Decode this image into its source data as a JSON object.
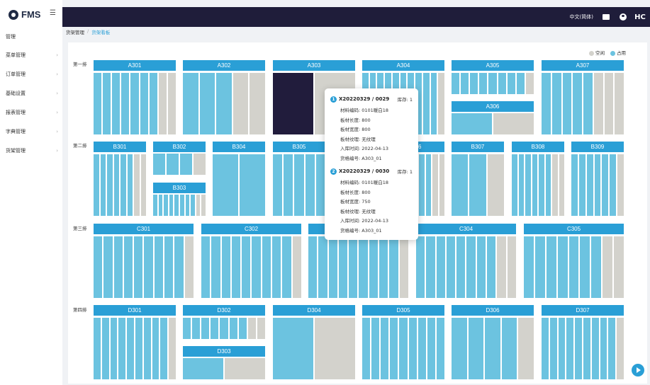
{
  "app": {
    "name": "FMS"
  },
  "sidebar": {
    "menu_toggle": "☰",
    "items": [
      {
        "label": "管理",
        "chevron": false
      },
      {
        "label": "菜单管理",
        "chevron": true
      },
      {
        "label": "订单管理",
        "chevron": true
      },
      {
        "label": "基础设置",
        "chevron": true
      },
      {
        "label": "报表管理",
        "chevron": true
      },
      {
        "label": "字典管理",
        "chevron": true
      },
      {
        "label": "货架管理",
        "chevron": true
      }
    ]
  },
  "topbar": {
    "language": "中文(简体)",
    "icons": [
      "mail-icon",
      "user-icon",
      "logo-mark-icon"
    ],
    "logo_mark": "HC"
  },
  "breadcrumb": {
    "parent": "货架管理",
    "separator": "/",
    "current": "货架看板"
  },
  "legend": {
    "empty": "空闲",
    "used": "占用",
    "empty_color": "#d3d2cc",
    "used_color": "#6cc3e0"
  },
  "rows": [
    {
      "label": "第一排"
    },
    {
      "label": "第二排"
    },
    {
      "label": "第三排"
    },
    {
      "label": "第四排"
    }
  ],
  "racks": {
    "A301": {
      "label": "A301",
      "slots": "uuuuuuuee"
    },
    "A302": {
      "label": "A302",
      "slots": "uuuee"
    },
    "A303": {
      "label": "A303",
      "slots": "se"
    },
    "A304": {
      "label": "A304",
      "slots": "uuuuuuuuuue"
    },
    "A305": {
      "label": "A305",
      "slots": "uuuuuuuue"
    },
    "A306": {
      "label": "A306",
      "slots": "ue"
    },
    "A307": {
      "label": "A307",
      "slots": "uuuuueee"
    },
    "B301": {
      "label": "B301",
      "slots": "uuuuuuee"
    },
    "B302": {
      "label": "B302",
      "slots": "uuue"
    },
    "B303": {
      "label": "B303",
      "slots": "uuuuuuuuee"
    },
    "B304": {
      "label": "B304",
      "slots": "uu"
    },
    "B305": {
      "label": "B305",
      "slots": "uuuuu"
    },
    "B306": {
      "label": "06",
      "slots": "uuuuuuee"
    },
    "B307": {
      "label": "B307",
      "slots": "uue"
    },
    "B308": {
      "label": "B308",
      "slots": "uuuuuuee"
    },
    "B309": {
      "label": "B309",
      "slots": "uuuuuue"
    },
    "C301": {
      "label": "C301",
      "slots": "uuuuuuuuue"
    },
    "C302": {
      "label": "C302",
      "slots": "uuuuuuuuue"
    },
    "C303": {
      "label": "",
      "slots": "uuuuuuuuue"
    },
    "C304": {
      "label": "C304",
      "slots": "uuuuuuuuee"
    },
    "C305": {
      "label": "C305",
      "slots": "uuuuuuuee"
    },
    "D301": {
      "label": "D301",
      "slots": "uuuuuuuuue"
    },
    "D302": {
      "label": "D302",
      "slots": "uuuuuuuee"
    },
    "D303": {
      "label": "D303",
      "slots": "ue"
    },
    "D304": {
      "label": "D304",
      "slots": "ue"
    },
    "D305": {
      "label": "D305",
      "slots": "uuuuuuuuu"
    },
    "D306": {
      "label": "D306",
      "slots": "uuuue"
    },
    "D307": {
      "label": "D307",
      "slots": "uuuuuuuuue"
    }
  },
  "tooltip": {
    "items": [
      {
        "index": "1",
        "code": "X20220329 / 0029",
        "stock": "库存: 1",
        "lines": [
          "材料编码: 0101暖白18",
          "板材长度: 800",
          "板材宽度: 800",
          "板材纹理: 无纹理",
          "入库时间: 2022-04-13",
          "货格编号: A303_01"
        ]
      },
      {
        "index": "2",
        "code": "X20220329 / 0030",
        "stock": "库存: 1",
        "lines": [
          "材料编码: 0101暖白18",
          "板材长度: 800",
          "板材宽度: 750",
          "板材纹理: 无纹理",
          "入库时间: 2022-04-13",
          "货格编号: A303_01"
        ]
      }
    ]
  }
}
